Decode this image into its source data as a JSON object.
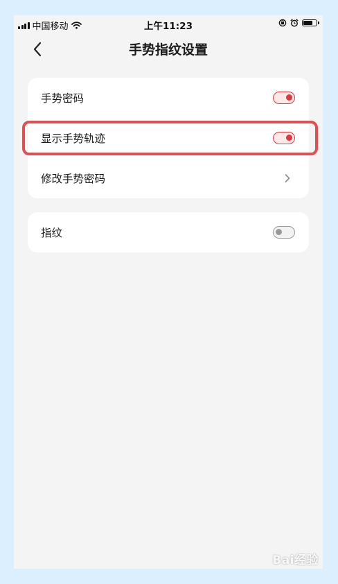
{
  "status_bar": {
    "carrier": "中国移动",
    "time": "上午11:23",
    "battery_level": 0.75,
    "icons": [
      "signal-icon",
      "wifi-icon",
      "rotation-lock-icon",
      "alarm-icon",
      "battery-icon"
    ]
  },
  "nav": {
    "title": "手势指纹设置",
    "back_icon": "back-chevron-icon"
  },
  "settings": {
    "group1": [
      {
        "label": "手势密码",
        "type": "toggle",
        "on": true
      },
      {
        "label": "显示手势轨迹",
        "type": "toggle",
        "on": true
      },
      {
        "label": "修改手势密码",
        "type": "link"
      }
    ],
    "group2": [
      {
        "label": "指纹",
        "type": "toggle",
        "on": false
      }
    ]
  },
  "colors": {
    "accent": "#e0373c",
    "accent_bg": "#fde8e8",
    "off": "#9a9a9a",
    "off_bg": "#f2f2f2",
    "highlight": "#e05050",
    "background": "#f4f4f4",
    "outer": "#dcefff"
  },
  "watermark": "Bai经验"
}
